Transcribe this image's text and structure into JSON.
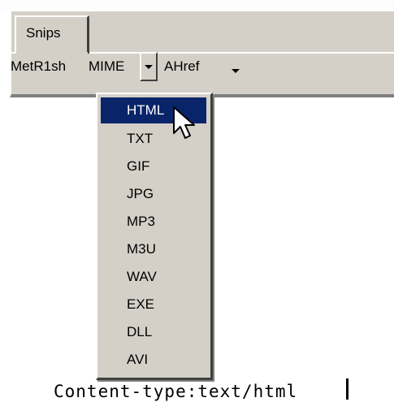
{
  "tabs": [
    {
      "label": "Snips"
    }
  ],
  "toolbar": {
    "items": [
      {
        "label": "MetR1sh"
      },
      {
        "label": "MIME"
      },
      {
        "label": "AHref"
      }
    ]
  },
  "dropdown": {
    "items": [
      "HTML",
      "TXT",
      "GIF",
      "JPG",
      "MP3",
      "M3U",
      "WAV",
      "EXE",
      "DLL",
      "AVI"
    ],
    "selected": "HTML"
  },
  "content": {
    "text": "Content-type:text/html"
  },
  "colors": {
    "panel": "#d4d0c8",
    "selection": "#0a246a"
  }
}
